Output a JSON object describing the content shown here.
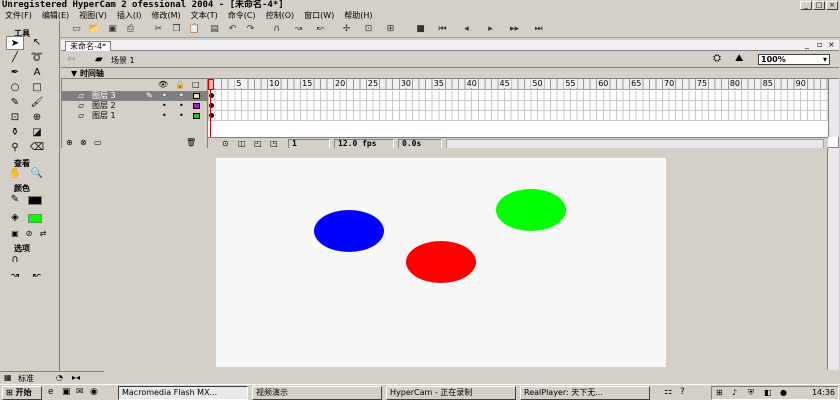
{
  "window": {
    "title": "Unregistered HyperCam 2 ofessional 2004 - [未命名-4*]",
    "min": "_",
    "max": "□",
    "close": "×"
  },
  "menu": [
    "文件(F)",
    "编辑(E)",
    "视图(V)",
    "插入(I)",
    "修改(M)",
    "文本(T)",
    "命令(C)",
    "控制(O)",
    "窗口(W)",
    "帮助(H)"
  ],
  "tools": {
    "header": "工具",
    "view_header": "查看",
    "colors_header": "颜色",
    "options_header": "选项"
  },
  "document": {
    "tab": "未命名-4*",
    "scene": "场景 1",
    "zoom": "100%",
    "timeline_label": "▼ 时间轴"
  },
  "layers": [
    {
      "name": "图层 3",
      "color": "#e0e0a0",
      "selected": true
    },
    {
      "name": "图层 2",
      "color": "#a020c0",
      "selected": false
    },
    {
      "name": "图层 1",
      "color": "#20c020",
      "selected": false
    }
  ],
  "ruler": [
    "1",
    "5",
    "10",
    "15",
    "20",
    "25",
    "30",
    "35",
    "40",
    "45",
    "50",
    "55",
    "60",
    "65",
    "70",
    "75",
    "80",
    "85",
    "90"
  ],
  "status": {
    "frame": "1",
    "fps": "12.0 fps",
    "time": "0.0s"
  },
  "stage": {
    "background": "#f8f8f8",
    "balls": [
      {
        "color": "#0000ff",
        "name": "blue-ball"
      },
      {
        "color": "#ff0000",
        "name": "red-ball"
      },
      {
        "color": "#00ff00",
        "name": "green-ball"
      }
    ]
  },
  "props": {
    "label": "标准"
  },
  "taskbar": {
    "start": "开始",
    "tasks": [
      "Macromedia Flash MX...",
      "视频演示",
      "HyperCam - 正在录制",
      "RealPlayer: 天下无..."
    ],
    "clock": "14:36"
  }
}
